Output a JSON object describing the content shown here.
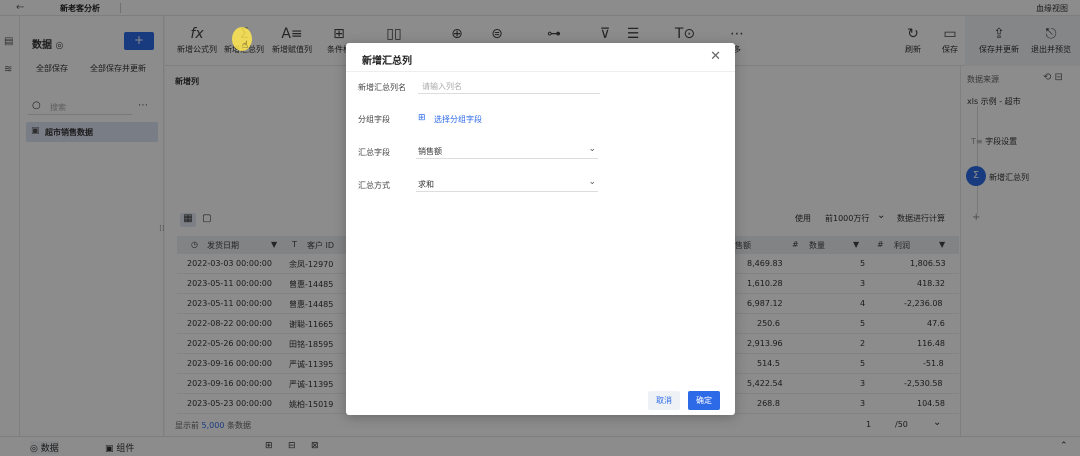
{
  "topbar": {
    "back_icon": "←",
    "title": "新老客分析",
    "view_label": "血缘视图"
  },
  "leftbar": {
    "icons": [
      "▤",
      "≋"
    ]
  },
  "data_panel": {
    "title": "数据",
    "title_icon": "◎",
    "add": "+",
    "save_all": "全部保存",
    "save_update": "全部保存并更新",
    "search_placeholder": "搜索",
    "search_icon": "○",
    "more_icon": "⋯",
    "dataset": "超市销售数据",
    "dataset_icon": "▣"
  },
  "toolbar": {
    "tools": [
      {
        "icon": "fx",
        "label": "新增公式列"
      },
      {
        "icon": "Σ",
        "label": "新增汇总列"
      },
      {
        "icon": "A≡",
        "label": "新增赋值列"
      },
      {
        "icon": "⊞",
        "label": "条件标"
      },
      {
        "icon": "▯▯",
        "label": ""
      },
      {
        "icon": "⊕",
        "label": ""
      },
      {
        "icon": "⊜",
        "label": ""
      },
      {
        "icon": "⊶",
        "label": ""
      },
      {
        "icon": "⊽",
        "label": ""
      },
      {
        "icon": "☰",
        "label": ""
      },
      {
        "icon": "T⊙",
        "label": ""
      },
      {
        "icon": "⋯",
        "label": "多"
      }
    ],
    "right_tools": [
      {
        "icon": "↻",
        "label": "刷新"
      },
      {
        "icon": "▭",
        "label": "保存"
      },
      {
        "icon": "⇪",
        "label": "保存并更新"
      },
      {
        "icon": "⎋",
        "label": "退出并预览"
      }
    ]
  },
  "main": {
    "section_label": "新增列",
    "view_icons": [
      "▦",
      "▢"
    ],
    "use_label": "使用",
    "rows_select": "前1000万行",
    "chevron": "⌄",
    "compute_label": "数据进行计算",
    "drag_handle": "⁞⁞",
    "columns": [
      {
        "icon": "◷",
        "name": "发货日期",
        "sort": "▼"
      },
      {
        "icon": "T",
        "name": "客户 ID"
      },
      {
        "name": "售额"
      },
      {
        "icon": "#",
        "name": "数量",
        "sort": "▼"
      },
      {
        "icon": "#",
        "name": "利润",
        "sort": "▼"
      }
    ],
    "rows": [
      {
        "date": "2022-03-03 00:00:00",
        "customer": "余凤-12970",
        "sales": "8,469.83",
        "qty": "5",
        "profit": "1,806.53"
      },
      {
        "date": "2023-05-11 00:00:00",
        "customer": "曾惠-14485",
        "sales": "1,610.28",
        "qty": "3",
        "profit": "418.32"
      },
      {
        "date": "2023-05-11 00:00:00",
        "customer": "曾惠-14485",
        "sales": "6,987.12",
        "qty": "4",
        "profit": "-2,236.08"
      },
      {
        "date": "2022-08-22 00:00:00",
        "customer": "谢聪-11665",
        "sales": "250.6",
        "qty": "5",
        "profit": "47.6"
      },
      {
        "date": "2022-05-26 00:00:00",
        "customer": "田铭-18595",
        "sales": "2,913.96",
        "qty": "2",
        "profit": "116.48"
      },
      {
        "date": "2023-09-16 00:00:00",
        "customer": "严诚-11395",
        "sales": "514.5",
        "qty": "5",
        "profit": "-51.8"
      },
      {
        "date": "2023-09-16 00:00:00",
        "customer": "严诚-11395",
        "sales": "5,422.54",
        "qty": "3",
        "profit": "-2,530.58"
      },
      {
        "date": "2023-05-23 00:00:00",
        "customer": "姚柏-15019",
        "sales": "268.8",
        "qty": "3",
        "profit": "104.58"
      }
    ],
    "footer_prefix": "显示前",
    "footer_count": "5,000",
    "footer_suffix": "条数据",
    "page_current": "1",
    "page_total": "/50"
  },
  "right_panel": {
    "title": "数据来源",
    "header_icons": "⟲ ⊟",
    "source_icon": "xls",
    "source": "示例 - 超市",
    "step1_icon": "T≡",
    "step1": "字段设置",
    "step2_icon": "Σ",
    "step2": "新增汇总列",
    "add": "+"
  },
  "bottombar": {
    "data_tab": "数据",
    "data_icon": "◎",
    "component_tab": "组件",
    "component_icon": "▣",
    "center_icons": [
      "⊞",
      "⊟",
      "⊠"
    ],
    "end_icon": "⌃"
  },
  "modal": {
    "title": "新增汇总列",
    "close": "✕",
    "name_label": "新增汇总列名",
    "name_placeholder": "请输入列名",
    "group_label": "分组字段",
    "group_link_icon": "⊞",
    "group_link": "选择分组字段",
    "agg_field_label": "汇总字段",
    "agg_field_value": "销售额",
    "agg_method_label": "汇总方式",
    "agg_method_value": "求和",
    "chevron": "⌄",
    "cancel": "取消",
    "ok": "确定"
  },
  "cursor_icon": "☝",
  "colors": {
    "accent": "#2d6ae8",
    "highlight": "#ffe650",
    "overlay": "rgba(0,0,0,0.45)"
  }
}
